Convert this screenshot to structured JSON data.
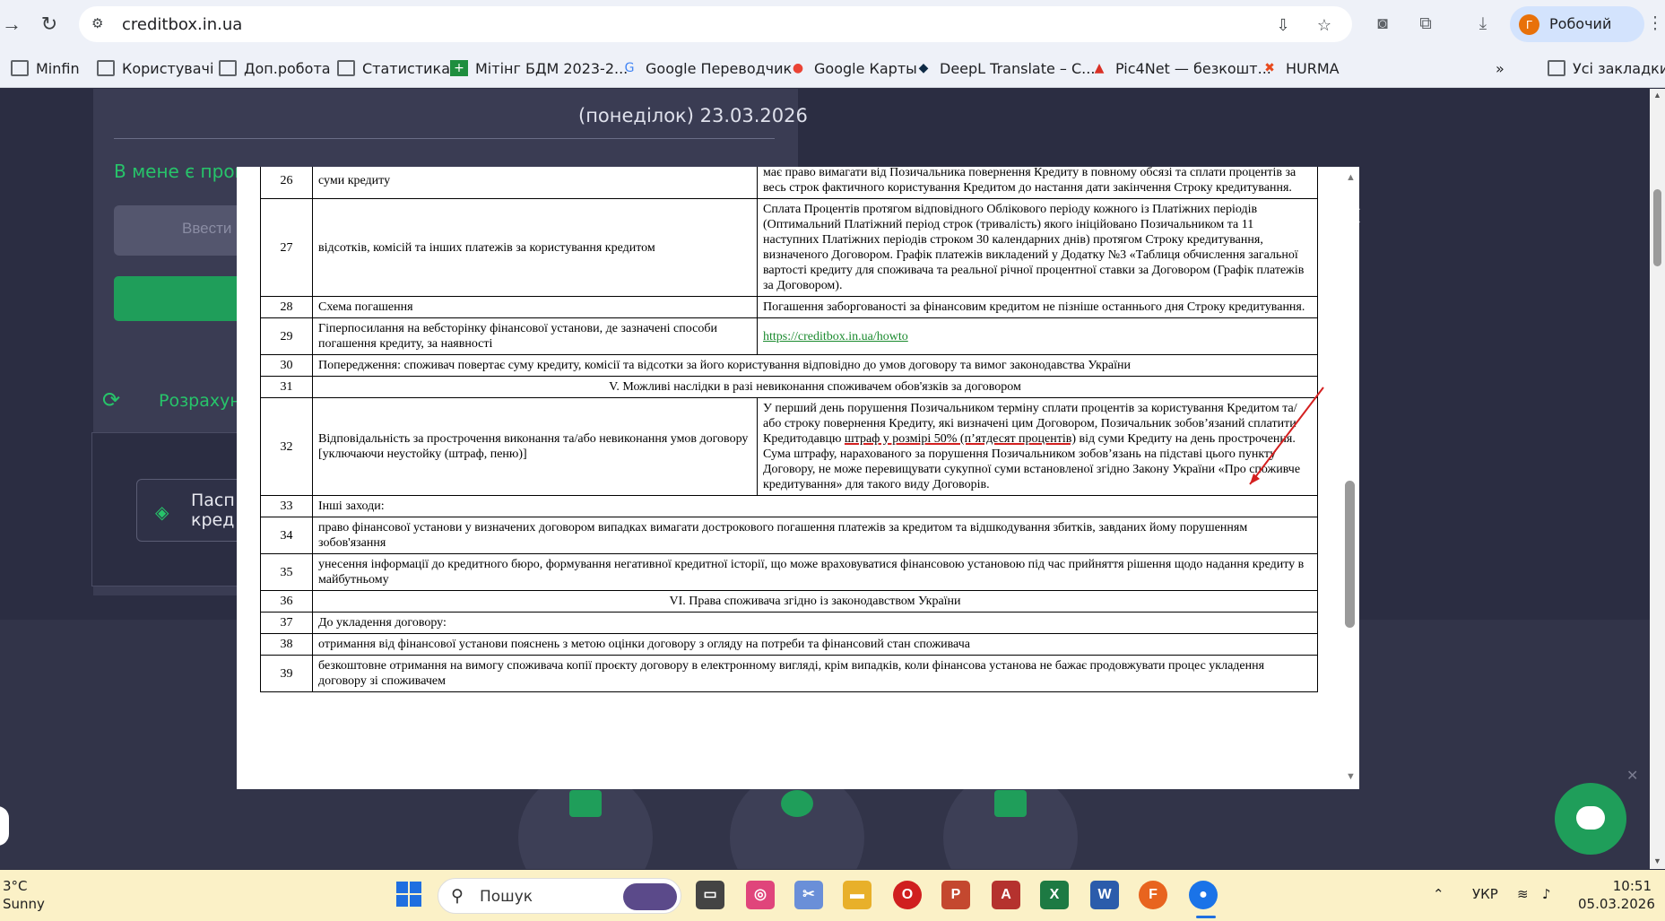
{
  "browser": {
    "url": "creditbox.in.ua",
    "profile_initial": "Г",
    "profile_label": "Робочий",
    "bookmarks": [
      {
        "label": "Minfin",
        "icon": "folder-icon"
      },
      {
        "label": "Користувачі",
        "icon": "folder-icon"
      },
      {
        "label": "Доп.робота",
        "icon": "folder-icon"
      },
      {
        "label": "Статистика",
        "icon": "folder-icon"
      },
      {
        "label": "Мітінг БДМ 2023-2...",
        "icon": "sheets-icon"
      },
      {
        "label": "Google Переводчик",
        "icon": "translate-icon"
      },
      {
        "label": "Google Карты",
        "icon": "maps-icon"
      },
      {
        "label": "DeepL Translate – С...",
        "icon": "deepl-icon"
      },
      {
        "label": "Pic4Net — безкошт...",
        "icon": "pic4net-icon"
      },
      {
        "label": "HURMA",
        "icon": "hurma-icon"
      }
    ],
    "more_bookmarks": "»",
    "all_bookmarks": "Усі закладки"
  },
  "site": {
    "date_text": "(понеділок) 23.03.2026",
    "promo_text": "В мене є пром",
    "promo_input_placeholder": "Ввести",
    "calc_text": "Розрахун",
    "passport_text_line1": "Пасп",
    "passport_text_line2": "кред"
  },
  "document": {
    "rows": [
      {
        "num": "26",
        "left": "суми кредиту",
        "right": "має право вимагати від Позичальника повернення Кредиту в повному обсязі та сплати процентів за весь строк фактичного користування Кредитом до настання дати закінчення Строку кредитування."
      },
      {
        "num": "27",
        "left": "відсотків, комісій та інших платежів за користування кредитом",
        "right": "Сплата Процентів протягом відповідного Облікового періоду кожного із Платіжних періодів (Оптимальний Платіжний період строк (тривалість) якого ініційовано Позичальником та 11 наступних Платіжних періодів строком 30 календарних днів) протягом Строку кредитування, визначеного Договором. Графік платежів викладений у Додатку №3 «Таблиця обчислення загальної вартості кредиту для споживача та реальної річної процентної ставки за Договором (Графік платежів за Договором)."
      },
      {
        "num": "28",
        "left": "Схема погашення",
        "right": "Погашення заборгованості за фінансовим кредитом не пізніше останнього дня Строку кредитування."
      },
      {
        "num": "29",
        "left": "Гіперпосилання на вебсторінку фінансової установи, де зазначені способи погашення кредиту, за наявності",
        "right_link": "https://creditbox.in.ua/howto"
      },
      {
        "num": "30",
        "span": "Попередження: споживач повертає суму кредиту, комісії та відсотки за його користування відповідно до умов договору та вимог законодавства України"
      },
      {
        "num": "31",
        "span_center": "V. Можливі наслідки в разі невиконання споживачем обов'язків за договором"
      },
      {
        "num": "32",
        "left": "Відповідальність за прострочення виконання та/або невиконання умов договору [уключаючи неустойку (штраф, пеню)]",
        "right_a": "У перший день порушення Позичальником терміну сплати процентів за користування Кредитом та/або строку повернення Кредиту, які визначені цим Договором, Позичальник зобов’язаний сплатити Кредитодавцю ",
        "right_highlight": "штраф у розмірі 50% (п’ятдесят процентів)",
        "right_b": " від суми Кредиту на день прострочення. Сума штрафу, нарахованого за порушення Позичальником зобов’язань на підставі цього пункту Договору, не може перевищувати сукупної суми встановленої згідно Закону України «Про споживче кредитування» для такого виду Договорів."
      },
      {
        "num": "33",
        "span": "Інші заходи:"
      },
      {
        "num": "34",
        "span": "право фінансової установи у визначених договором випадках вимагати дострокового погашення платежів за кредитом та відшкодування збитків, завданих йому порушенням зобов'язання"
      },
      {
        "num": "35",
        "span": "унесення інформації до кредитного бюро, формування негативної кредитної історії, що може враховуватися фінансовою установою під час прийняття рішення щодо надання кредиту в майбутньому"
      },
      {
        "num": "36",
        "span_center": "VI. Права споживача згідно із законодавством України"
      },
      {
        "num": "37",
        "span": "До укладення договору:"
      },
      {
        "num": "38",
        "span": "отримання від фінансової установи пояснень з метою оцінки договору з огляду на потреби та фінансовий стан споживача"
      },
      {
        "num": "39",
        "span": "безкоштовне отримання на вимогу споживача копії проєкту договору в електронному вигляді, крім випадків, коли фінансова установа не бажає продовжувати процес укладення договору зі споживачем"
      }
    ]
  },
  "taskbar": {
    "weather_temp": "3°C",
    "weather_desc": "Sunny",
    "search_label": "Пошук",
    "lang": "УКР",
    "time": "10:51",
    "date": "05.03.2026"
  },
  "colors": {
    "accent_green": "#27c46a",
    "page_bg": "#2b2d42",
    "annotation_red": "#d42020"
  }
}
